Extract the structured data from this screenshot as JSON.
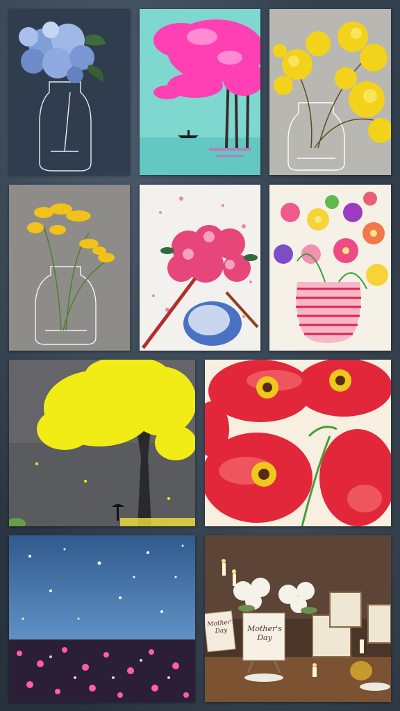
{
  "gallery": {
    "tiles": [
      {
        "subject": "Blue hydrangeas in glass jar painting"
      },
      {
        "subject": "Pink tree over teal lake with boat painting"
      },
      {
        "subject": "Yellow mimosa in glass vase painting"
      },
      {
        "subject": "Yellow flowers in glass bottle painting"
      },
      {
        "subject": "Pink hydrangea in blue vase being painted"
      },
      {
        "subject": "Colorful flowers in striped pink vase"
      },
      {
        "subject": "Yellow tree with figure under umbrella painting"
      },
      {
        "subject": "Red poppies watercolor"
      },
      {
        "subject": "Starry sky over pink flower field painting"
      },
      {
        "subject": "Mother's Day painting party table setting"
      }
    ],
    "sign_text": [
      "Mother's",
      "Day"
    ],
    "accent_colors": {
      "background": "#2b3440",
      "hydrangea_blue": "#7f9fd8",
      "tree_pink": "#ff3fb4",
      "mimosa_yellow": "#f2d21a",
      "poppy_red": "#e3273a"
    }
  }
}
